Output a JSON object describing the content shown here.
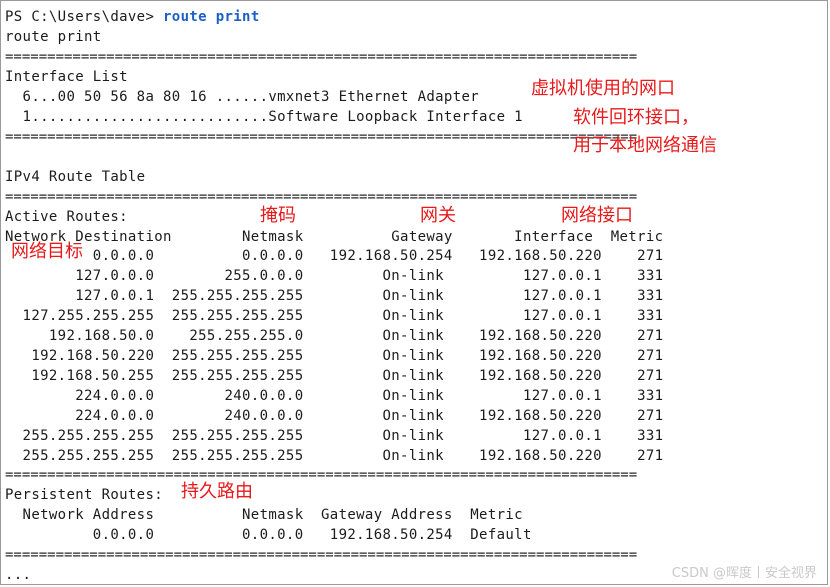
{
  "prompt": {
    "prefix": "PS C:\\Users\\dave> ",
    "command": "route print"
  },
  "echo": "route print",
  "rule": "===========================================================================",
  "interface_list": {
    "title": "Interface List",
    "items": [
      "  6...00 50 56 8a 80 16 ......vmxnet3 Ethernet Adapter",
      "  1...........................Software Loopback Interface 1"
    ]
  },
  "ipv4_title": "IPv4 Route Table",
  "active_routes_title": "Active Routes:",
  "active_header": "Network Destination        Netmask          Gateway       Interface  Metric",
  "active_rows": [
    "          0.0.0.0          0.0.0.0   192.168.50.254   192.168.50.220    271",
    "        127.0.0.0        255.0.0.0         On-link         127.0.0.1    331",
    "        127.0.0.1  255.255.255.255         On-link         127.0.0.1    331",
    "  127.255.255.255  255.255.255.255         On-link         127.0.0.1    331",
    "     192.168.50.0    255.255.255.0         On-link    192.168.50.220    271",
    "   192.168.50.220  255.255.255.255         On-link    192.168.50.220    271",
    "   192.168.50.255  255.255.255.255         On-link    192.168.50.220    271",
    "        224.0.0.0        240.0.0.0         On-link         127.0.0.1    331",
    "        224.0.0.0        240.0.0.0         On-link    192.168.50.220    271",
    "  255.255.255.255  255.255.255.255         On-link         127.0.0.1    331",
    "  255.255.255.255  255.255.255.255         On-link    192.168.50.220    271"
  ],
  "persistent_title": "Persistent Routes:",
  "persistent_header": "  Network Address          Netmask  Gateway Address  Metric",
  "persistent_rows": [
    "          0.0.0.0          0.0.0.0   192.168.50.254  Default"
  ],
  "ellipsis": "...",
  "annotations": {
    "vm_nic": "虚拟机使用的网口",
    "loopback_1": "软件回环接口，",
    "loopback_2": "用于本地网络通信",
    "netmask": "掩码",
    "gateway": "网关",
    "interface": "网络接口",
    "destination": "网络目标",
    "persistent": "持久路由"
  },
  "watermark": "CSDN @晖度丨安全视界",
  "colors": {
    "annotation": "#e8191a",
    "command": "#1c5fc7",
    "text": "#1b1b1b"
  }
}
